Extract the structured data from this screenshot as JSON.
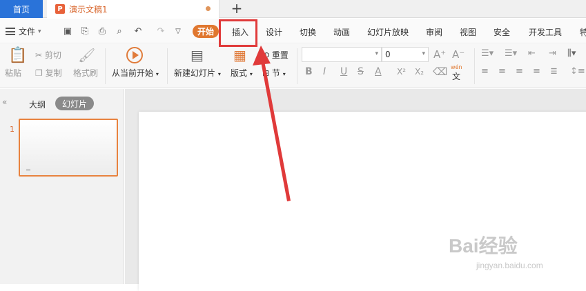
{
  "tabs": {
    "home": "首页",
    "doc_title": "演示文稿1",
    "doc_icon_letter": "P",
    "new_tab": "+"
  },
  "menu": {
    "file": "文件",
    "start": "开始",
    "items": [
      "插入",
      "设计",
      "切换",
      "动画",
      "幻灯片放映",
      "审阅",
      "视图",
      "安全",
      "开发工具",
      "特"
    ]
  },
  "ribbon": {
    "paste": "粘贴",
    "cut": "剪切",
    "copy": "复制",
    "format_painter": "格式刷",
    "from_current": "从当前开始",
    "new_slide": "新建幻灯片",
    "layout": "版式",
    "reset": "重置",
    "section": "节",
    "font_name": "",
    "font_size": "0",
    "bold": "B",
    "italic": "I",
    "underline": "U",
    "strike": "S",
    "font_color": "A",
    "superscript": "X²",
    "subscript": "X₂",
    "wen_label": "wén",
    "wen_char": "文",
    "grow_font": "A⁺",
    "shrink_font": "A⁻"
  },
  "left_panel": {
    "collapse_icon": "«",
    "outline": "大纲",
    "slides": "幻灯片",
    "slide_number": "1"
  },
  "watermark": {
    "brand": "Bai经验",
    "url": "jingyan.baidu.com"
  },
  "colors": {
    "home_tab": "#2a73d9",
    "accent_orange": "#e0772f",
    "highlight_red": "#e03a3a"
  }
}
